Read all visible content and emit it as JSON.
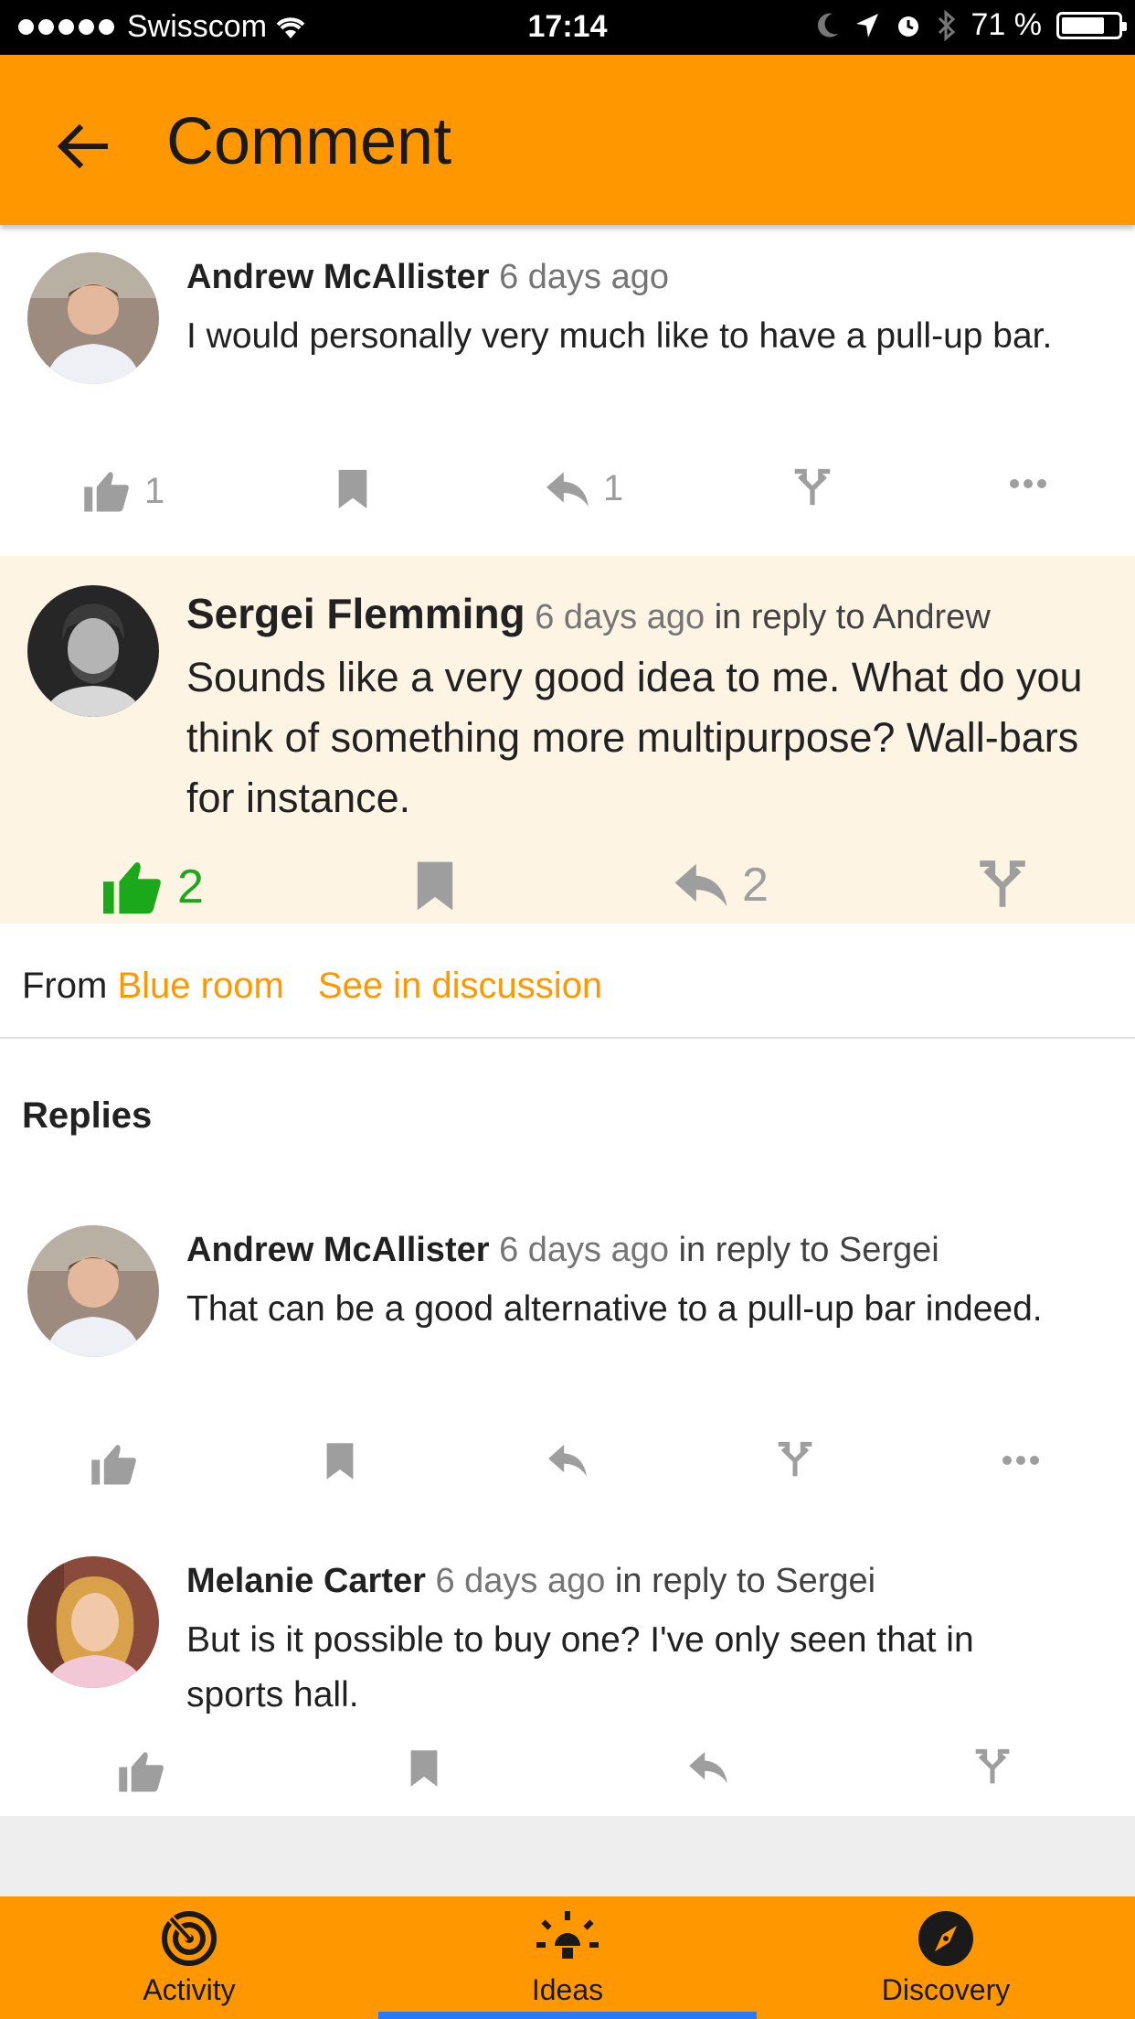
{
  "status_bar": {
    "carrier": "Swisscom",
    "time": "17:14",
    "battery": "71 %"
  },
  "app_bar": {
    "title": "Comment"
  },
  "main_comment": {
    "author": "Andrew McAllister",
    "time": "6 days ago",
    "text": "I would personally very much like to have a pull-up bar.",
    "likes": "1",
    "replies": "1"
  },
  "highlighted_comment": {
    "author": "Sergei Flemming",
    "time": "6 days ago",
    "reply_to": "in reply to Andrew",
    "text": "Sounds like a very good idea to me. What do you think of something more multipurpose? Wall-bars for instance.",
    "likes": "2",
    "replies": "2",
    "like_color": "#1BA91B"
  },
  "source": {
    "from_label": "From",
    "room": "Blue room",
    "see_discussion": "See in discussion"
  },
  "replies_heading": "Replies",
  "replies": [
    {
      "author": "Andrew McAllister",
      "time": "6 days ago",
      "reply_to": "in reply to Sergei",
      "text": "That can be a good alternative to a pull-up bar indeed."
    },
    {
      "author": "Melanie Carter",
      "time": "6 days ago",
      "reply_to": "in reply to Sergei",
      "text": "But is it possible to buy one? I've only seen that in sports hall."
    }
  ],
  "bottom_nav": {
    "items": [
      {
        "label": "Activity",
        "icon": "activity-icon"
      },
      {
        "label": "Ideas",
        "icon": "lightbulb-icon",
        "active": true
      },
      {
        "label": "Discovery",
        "icon": "compass-icon"
      }
    ],
    "accent": "#FF9800",
    "indicator": "#2979FF"
  }
}
